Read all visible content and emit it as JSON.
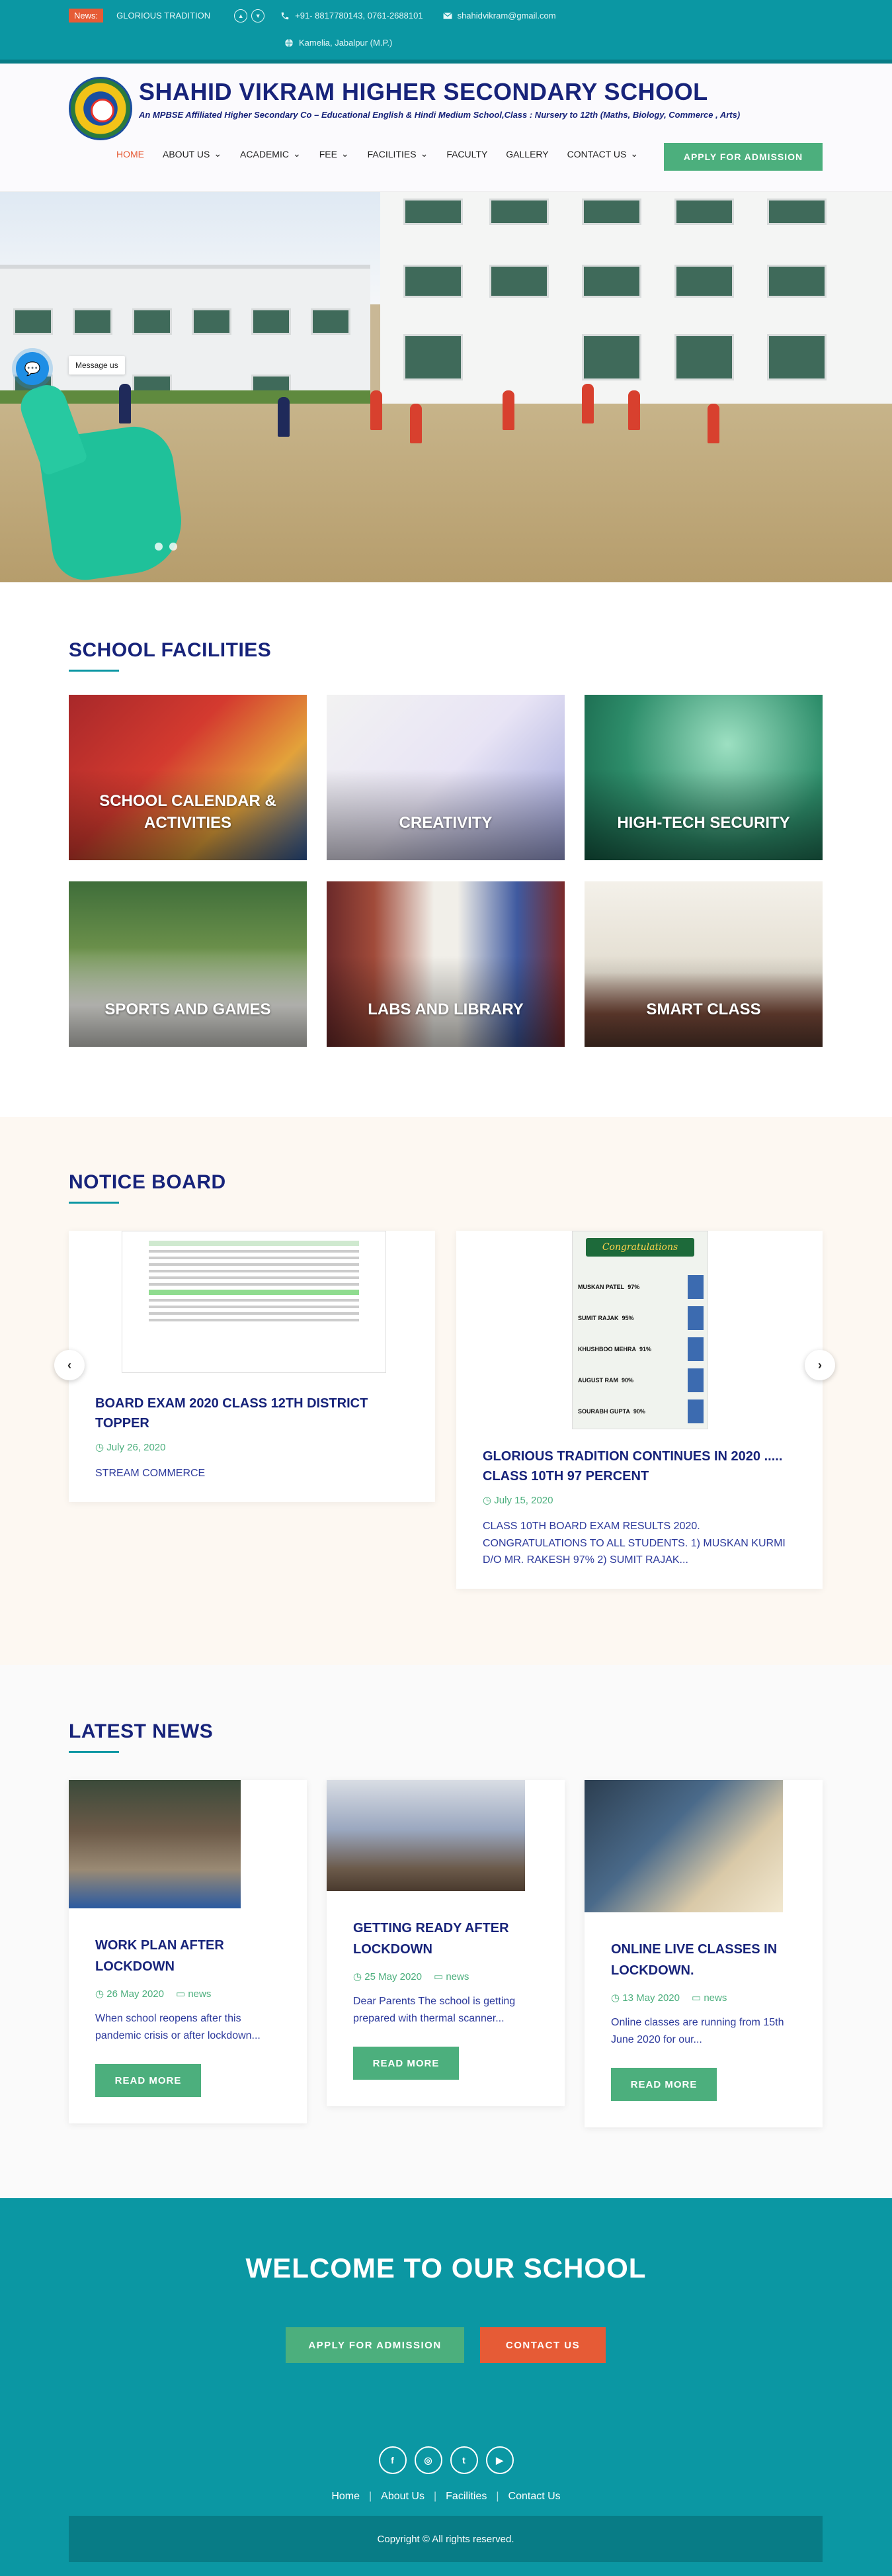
{
  "topbar": {
    "news_tag": "News:",
    "news_text": "GLORIOUS TRADITION",
    "phone": "+91- 8817780143, 0761-2688101",
    "email": "shahidvikram@gmail.com",
    "location": "Kamelia, Jabalpur (M.P.)"
  },
  "header": {
    "school_name": "SHAHID VIKRAM HIGHER SECONDARY SCHOOL",
    "subtitle": "An MPBSE Affiliated Higher Secondary Co – Educational English & Hindi Medium School,Class : Nursery to 12th (Maths, Biology, Commerce , Arts)"
  },
  "nav": {
    "items": [
      {
        "label": "HOME",
        "dropdown": false
      },
      {
        "label": "ABOUT US",
        "dropdown": true
      },
      {
        "label": "ACADEMIC",
        "dropdown": true
      },
      {
        "label": "FEE",
        "dropdown": true
      },
      {
        "label": "FACILITIES",
        "dropdown": true
      },
      {
        "label": "FACULTY",
        "dropdown": false
      },
      {
        "label": "GALLERY",
        "dropdown": false
      },
      {
        "label": "CONTACT US",
        "dropdown": true
      }
    ],
    "apply_label": "APPLY FOR ADMISSION"
  },
  "hero": {
    "message_label": "Message us"
  },
  "facilities": {
    "title": "SCHOOL FACILITIES",
    "cards": [
      {
        "label": "SCHOOL CALENDAR & ACTIVITIES"
      },
      {
        "label": "CREATIVITY"
      },
      {
        "label": "HIGH-TECH SECURITY"
      },
      {
        "label": "SPORTS AND GAMES"
      },
      {
        "label": "LABS AND LIBRARY"
      },
      {
        "label": "SMART CLASS"
      }
    ]
  },
  "notice": {
    "title": "NOTICE BOARD",
    "cards": [
      {
        "title": "BOARD EXAM 2020 CLASS 12TH DISTRICT TOPPER",
        "date": "July 26, 2020",
        "desc": "STREAM COMMERCE"
      },
      {
        "title": "GLORIOUS TRADITION CONTINUES IN 2020 ..... CLASS 10TH 97 PERCENT",
        "date": "July 15, 2020",
        "desc": "CLASS 10TH BOARD EXAM RESULTS 2020. CONGRATULATIONS TO ALL STUDENTS. 1) MUSKAN KURMI D/O MR. RAKESH 97% 2) SUMIT RAJAK..."
      }
    ],
    "poster": {
      "banner": "Congratulations",
      "rows": [
        {
          "name": "MUSKAN PATEL",
          "score": "97%"
        },
        {
          "name": "SUMIT RAJAK",
          "score": "95%"
        },
        {
          "name": "KHUSHBOO MEHRA",
          "score": "91%"
        },
        {
          "name": "AUGUST RAM",
          "score": "90%"
        },
        {
          "name": "SOURABH GUPTA",
          "score": "90%"
        }
      ]
    }
  },
  "news": {
    "title": "LATEST NEWS",
    "read_more": "READ MORE",
    "cards": [
      {
        "title": "WORK PLAN AFTER LOCKDOWN",
        "date": "26 May 2020",
        "category": "news",
        "desc": "When school reopens after this pandemic crisis or after lockdown..."
      },
      {
        "title": "GETTING READY AFTER LOCKDOWN",
        "date": "25 May 2020",
        "category": "news",
        "desc": "Dear Parents The school is getting prepared with thermal scanner..."
      },
      {
        "title": "ONLINE LIVE CLASSES IN LOCKDOWN.",
        "date": "13 May 2020",
        "category": "news",
        "desc": "Online classes are running from 15th June 2020 for our..."
      }
    ]
  },
  "footer": {
    "welcome": "WELCOME TO OUR SCHOOL",
    "apply": "APPLY FOR ADMISSION",
    "contact": "CONTACT US",
    "links": [
      "Home",
      "About Us",
      "Facilities",
      "Contact Us"
    ],
    "copyright": "Copyright © All rights reserved."
  },
  "colors": {
    "teal": "#0b97a3",
    "navy": "#17237a",
    "green": "#4caf7d",
    "orange": "#e65b36"
  }
}
